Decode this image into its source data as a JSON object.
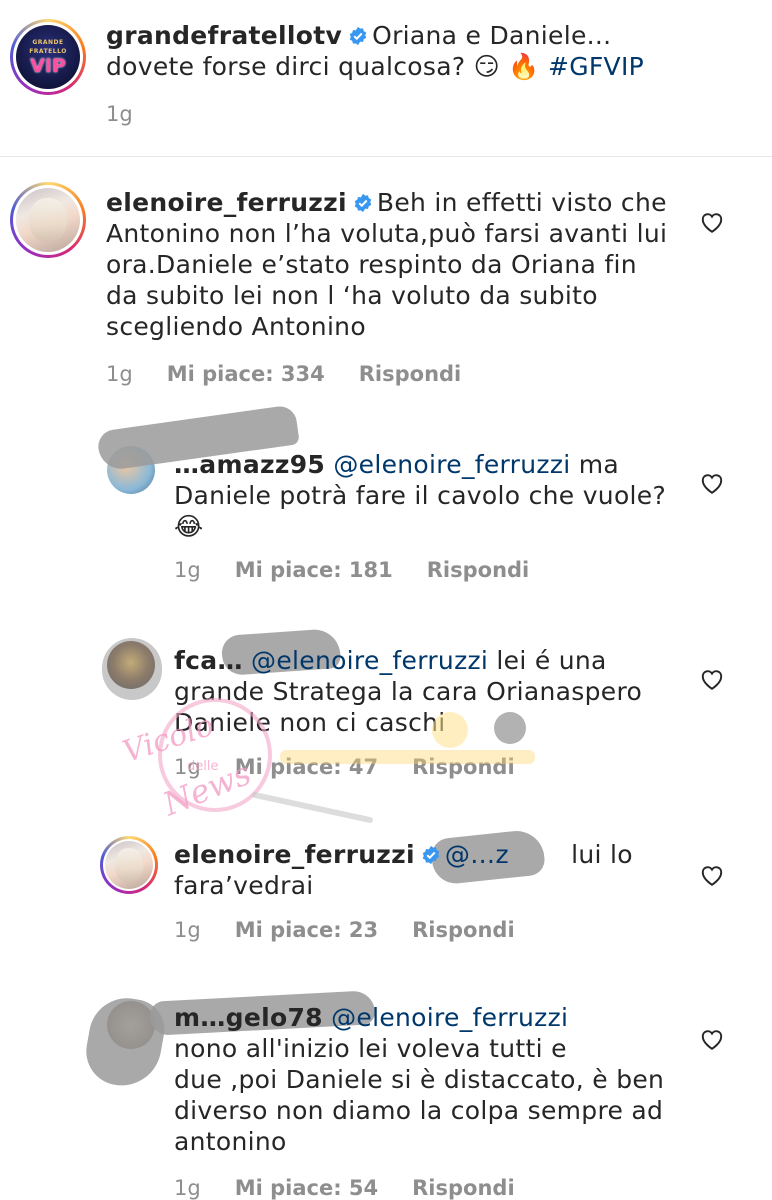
{
  "caption": {
    "username": "grandefratellotv",
    "text": "Oriana e Daniele... dovete forse dirci qualcosa? 😏 🔥",
    "hashtag": "#GFVIP",
    "time": "1g",
    "avatar_text_top": "GRANDE FRATELLO",
    "avatar_text_vip": "VIP"
  },
  "comments": [
    {
      "username": "elenoire_ferruzzi",
      "text_line1": "Beh in effetti visto che",
      "text_line2": "Antonino non l’ha voluta,può farsi avanti lui",
      "text_line3": "ora.Daniele e’stato respinto da Oriana fin",
      "text_line4": "da subito lei non l ‘ha voluto da subito",
      "text_line5": "scegliendo Antonino",
      "time": "1g",
      "likes": "Mi piace: 334",
      "reply": "Rispondi"
    },
    {
      "username": "…amazz95",
      "mention": "@elenoire_ferruzzi",
      "text_line1": "ma",
      "text_line2": "Daniele potrà fare il cavolo che vuole?",
      "text_line3": "😂",
      "time": "1g",
      "likes": "Mi piace: 181",
      "reply": "Rispondi"
    },
    {
      "username": "fca…",
      "mention": "@elenoire_ferruzzi",
      "text_line1": "lei é una",
      "text_line2": "grande Stratega la cara Orianaspero",
      "text_line3": "Daniele non ci caschi",
      "time": "1g",
      "likes": "Mi piace: 47",
      "reply": "Rispondi"
    },
    {
      "username": "elenoire_ferruzzi",
      "mention": "@…z",
      "text_line1": "lui lo",
      "text_line2": "fara’vedrai",
      "time": "1g",
      "likes": "Mi piace: 23",
      "reply": "Rispondi"
    },
    {
      "username": "m…gelo78",
      "mention": "@elenoire_ferruzzi",
      "text_line1": "nono all'inizio lei voleva tutti e",
      "text_line2": "due ,poi Daniele si è distaccato, è ben",
      "text_line3": "diverso non diamo la colpa sempre ad",
      "text_line4": "antonino",
      "time": "1g",
      "likes": "Mi piace: 54",
      "reply": "Rispondi"
    }
  ],
  "watermark": {
    "line1": "Vicolo",
    "line2": "delle",
    "line3": "News"
  },
  "colors": {
    "text": "#262626",
    "muted": "#8e8e8e",
    "link": "#00376b",
    "verified": "#3897f0",
    "divider": "#e6e6e6"
  }
}
